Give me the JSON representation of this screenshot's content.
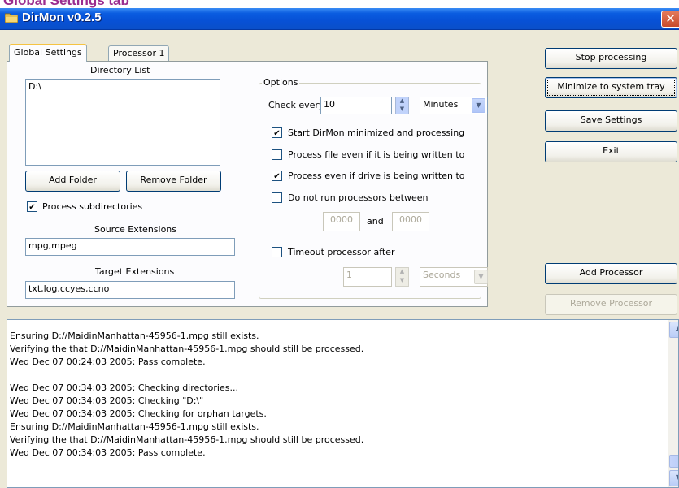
{
  "page_title": "Global Settings tab",
  "window": {
    "title": "DirMon v0.2.5",
    "close_glyph": "✕"
  },
  "tabs": [
    {
      "label": "Global Settings",
      "active": true
    },
    {
      "label": "Processor 1",
      "active": false
    }
  ],
  "directory": {
    "label": "Directory List",
    "items": [
      "D:\\"
    ],
    "add_label": "Add Folder",
    "remove_label": "Remove Folder"
  },
  "process_subdirs": {
    "label": "Process subdirectories",
    "checked": true
  },
  "source_ext": {
    "label": "Source Extensions",
    "value": "mpg,mpeg"
  },
  "target_ext": {
    "label": "Target Extensions",
    "value": "txt,log,ccyes,ccno"
  },
  "options": {
    "title": "Options",
    "check_every_label": "Check every",
    "check_every_value": "10",
    "check_every_unit": "Minutes",
    "checkboxes": [
      {
        "label": "Start DirMon minimized and processing",
        "checked": true
      },
      {
        "label": "Process file even if it is being written to",
        "checked": false
      },
      {
        "label": "Process even if drive is being written to",
        "checked": true
      },
      {
        "label": "Do not run processors between",
        "checked": false
      }
    ],
    "between_from": "0000",
    "between_and": "and",
    "between_to": "0000",
    "timeout_label": "Timeout processor after",
    "timeout_checked": false,
    "timeout_value": "1",
    "timeout_unit": "Seconds"
  },
  "side_buttons": {
    "stop": "Stop processing",
    "minimize": "Minimize to system tray",
    "save": "Save Settings",
    "exit": "Exit",
    "add_processor": "Add Processor",
    "remove_processor": "Remove Processor"
  },
  "log_lines": [
    "Ensuring D://MaidinManhattan-45956-1.mpg still exists.",
    "Verifying the that D://MaidinManhattan-45956-1.mpg should still be processed.",
    "Wed Dec 07 00:24:03 2005: Pass complete.",
    "",
    "Wed Dec 07 00:34:03 2005: Checking directories...",
    "Wed Dec 07 00:34:03 2005: Checking \"D:\\\"",
    "Wed Dec 07 00:34:03 2005: Checking for orphan targets.",
    "Ensuring D://MaidinManhattan-45956-1.mpg still exists.",
    "Verifying the that D://MaidinManhattan-45956-1.mpg should still be processed.",
    "Wed Dec 07 00:34:03 2005: Pass complete."
  ],
  "colors": {
    "titlebar": "#0751d6",
    "client": "#ece9d8",
    "page_title": "#9b2c8f"
  }
}
